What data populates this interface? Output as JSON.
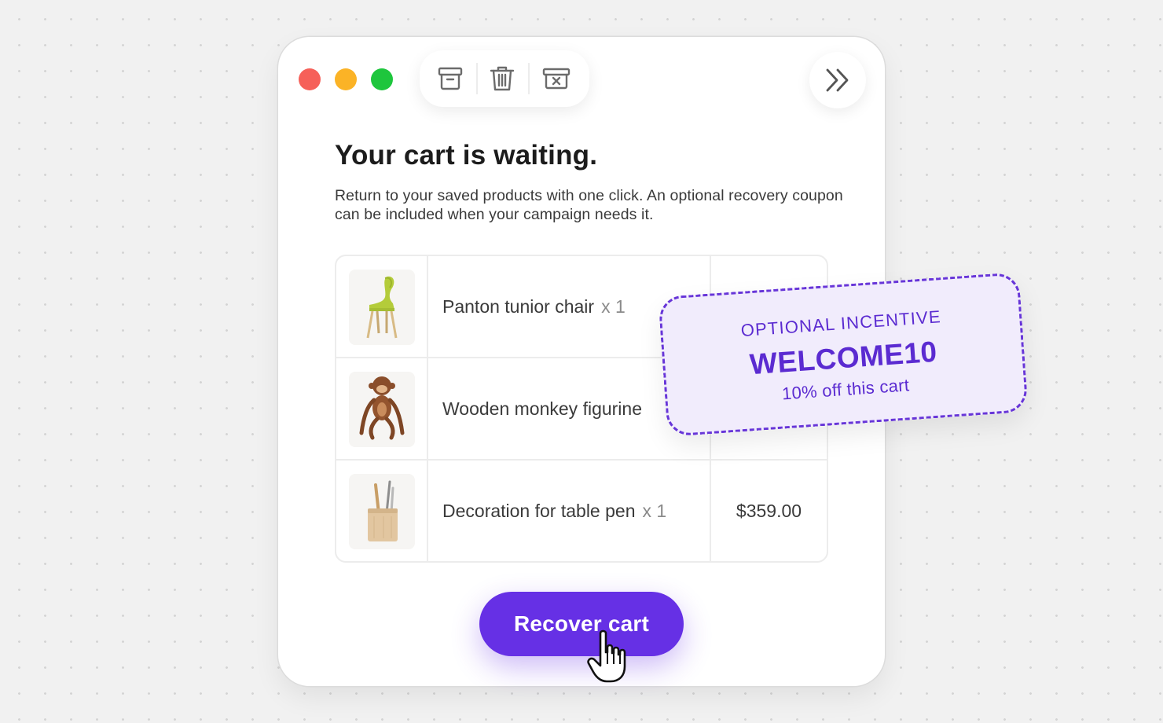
{
  "window_controls": [
    {
      "name": "close",
      "color": "#f66059"
    },
    {
      "name": "minimize",
      "color": "#fbb326"
    },
    {
      "name": "maximize",
      "color": "#1ec63d"
    }
  ],
  "toolbar": {
    "icons": [
      "archive-icon",
      "trash-icon",
      "archive-remove-icon"
    ],
    "expand_icon": "double-chevron-right-icon"
  },
  "heading": "Your cart is waiting.",
  "description": "Return to your saved products with one click. An optional recovery coupon can be included when your campaign needs it.",
  "cart": {
    "items": [
      {
        "name": "Panton tunior chair",
        "qty": "x 1",
        "price": "",
        "thumb_icon": "chair-icon"
      },
      {
        "name": "Wooden monkey figurine",
        "qty": "",
        "price": "",
        "thumb_icon": "monkey-figurine-icon"
      },
      {
        "name": "Decoration for table pen",
        "qty": "x 1",
        "price": "$359.00",
        "thumb_icon": "pen-holder-icon"
      }
    ]
  },
  "coupon": {
    "label": "OPTIONAL INCENTIVE",
    "code": "WELCOME10",
    "description": "10% off this cart"
  },
  "cta": {
    "label": "Recover cart"
  },
  "colors": {
    "accent": "#6630e5",
    "coupon_background": "#f1ecfc",
    "coupon_text": "#5b2bd1"
  }
}
